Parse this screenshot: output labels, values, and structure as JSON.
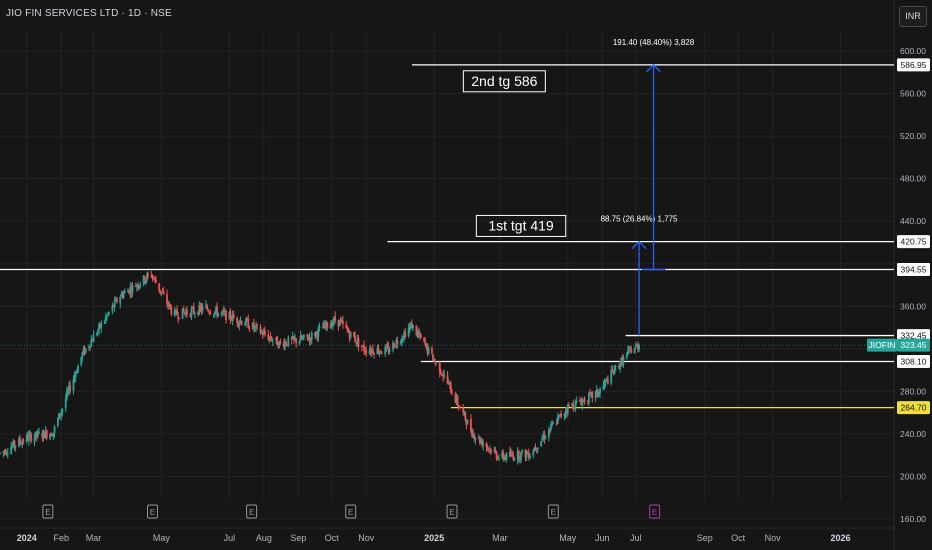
{
  "header": {
    "title": "JIO FIN SERVICES LTD · 1D · NSE",
    "currency": "INR"
  },
  "colors": {
    "up": "#26a69a",
    "down": "#ef5350",
    "text": "#d1d4dc",
    "arrow": "#2962ff",
    "yellow_line": "#f2de3a",
    "bg": "#161616",
    "grid": "#232323"
  },
  "chart_data": {
    "type": "candlestick",
    "ylim": [
      160,
      610
    ],
    "y_ticks": [
      160,
      200,
      240,
      280,
      320,
      360,
      400,
      440,
      480,
      520,
      560,
      600
    ],
    "y_tick_labels": [
      "160.00",
      "200.00",
      "240.00",
      "280.00",
      "",
      "360.00",
      "",
      "440.00",
      "480.00",
      "520.00",
      "560.00",
      "600.00"
    ],
    "x_labels": [
      {
        "label": "2024",
        "date": "2024-01-01",
        "bold": true
      },
      {
        "label": "Feb",
        "date": "2024-02-01"
      },
      {
        "label": "Mar",
        "date": "2024-03-01"
      },
      {
        "label": "May",
        "date": "2024-05-01"
      },
      {
        "label": "Jul",
        "date": "2024-07-01"
      },
      {
        "label": "Aug",
        "date": "2024-08-01"
      },
      {
        "label": "Sep",
        "date": "2024-09-01"
      },
      {
        "label": "Oct",
        "date": "2024-10-01"
      },
      {
        "label": "Nov",
        "date": "2024-11-01"
      },
      {
        "label": "2025",
        "date": "2025-01-01",
        "bold": true
      },
      {
        "label": "Mar",
        "date": "2025-03-01"
      },
      {
        "label": "May",
        "date": "2025-05-01"
      },
      {
        "label": "Jun",
        "date": "2025-06-01"
      },
      {
        "label": "Jul",
        "date": "2025-07-01"
      },
      {
        "label": "Sep",
        "date": "2025-09-01"
      },
      {
        "label": "Oct",
        "date": "2025-10-01"
      },
      {
        "label": "Nov",
        "date": "2025-11-01"
      },
      {
        "label": "2026",
        "date": "2026-01-01",
        "bold": true
      }
    ],
    "x_range": [
      "2023-12-08",
      "2026-02-18"
    ],
    "earnings_markers": [
      {
        "label": "E",
        "date": "2024-01-20"
      },
      {
        "label": "E",
        "date": "2024-04-23"
      },
      {
        "label": "E",
        "date": "2024-07-21"
      },
      {
        "label": "E",
        "date": "2024-10-18"
      },
      {
        "label": "E",
        "date": "2025-01-17"
      },
      {
        "label": "E",
        "date": "2025-04-18"
      },
      {
        "label": "E",
        "date": "2025-07-18",
        "upcoming": true
      }
    ],
    "price_path": [
      {
        "date": "2023-12-08",
        "price": 222
      },
      {
        "date": "2024-01-01",
        "price": 236
      },
      {
        "date": "2024-01-25",
        "price": 242
      },
      {
        "date": "2024-02-20",
        "price": 315
      },
      {
        "date": "2024-03-25",
        "price": 370
      },
      {
        "date": "2024-04-22",
        "price": 390
      },
      {
        "date": "2024-05-12",
        "price": 352
      },
      {
        "date": "2024-06-10",
        "price": 358
      },
      {
        "date": "2024-07-15",
        "price": 345
      },
      {
        "date": "2024-08-15",
        "price": 325
      },
      {
        "date": "2024-09-10",
        "price": 330
      },
      {
        "date": "2024-10-05",
        "price": 348
      },
      {
        "date": "2024-10-30",
        "price": 320
      },
      {
        "date": "2024-11-20",
        "price": 318
      },
      {
        "date": "2024-12-12",
        "price": 342
      },
      {
        "date": "2025-01-08",
        "price": 298
      },
      {
        "date": "2025-02-05",
        "price": 240
      },
      {
        "date": "2025-03-01",
        "price": 218
      },
      {
        "date": "2025-03-28",
        "price": 222
      },
      {
        "date": "2025-05-01",
        "price": 265
      },
      {
        "date": "2025-05-28",
        "price": 278
      },
      {
        "date": "2025-06-12",
        "price": 300
      },
      {
        "date": "2025-06-26",
        "price": 318
      },
      {
        "date": "2025-07-04",
        "price": 323.45
      }
    ],
    "horizontal_lines": [
      {
        "price": 586.95,
        "from": "2024-12-12",
        "color": "#ffffff",
        "label": "586.95"
      },
      {
        "price": 420.75,
        "from": "2024-11-20",
        "color": "#ffffff",
        "label": "420.75"
      },
      {
        "price": 394.55,
        "from": "2023-12-08",
        "color": "#ffffff",
        "label": "394.55"
      },
      {
        "price": 332.45,
        "from": "2025-06-22",
        "color": "#ffffff",
        "label": "332.45"
      },
      {
        "price": 308.1,
        "from": "2024-12-20",
        "color": "#ffffff",
        "label": "308.10"
      },
      {
        "price": 264.7,
        "from": "2025-01-16",
        "color": "#f2de3a",
        "label": "264.70"
      }
    ],
    "last_price": {
      "symbol": "JIOFIN",
      "value": "323.45",
      "price": 323.45
    },
    "measure_arrows": [
      {
        "date": "2025-07-04",
        "from_price": 332.45,
        "to_price": 420.75,
        "label": "88.75 (26.84%) 1,775"
      },
      {
        "date": "2025-07-17",
        "from_price": 394.55,
        "to_price": 586.95,
        "label": "191.40 (48.40%) 3,828"
      }
    ],
    "annotations": [
      {
        "text": "2nd tg 586",
        "date": "2025-03-05",
        "price": 572
      },
      {
        "text": "1st tgt 419",
        "date": "2025-03-20",
        "price": 436
      }
    ]
  }
}
